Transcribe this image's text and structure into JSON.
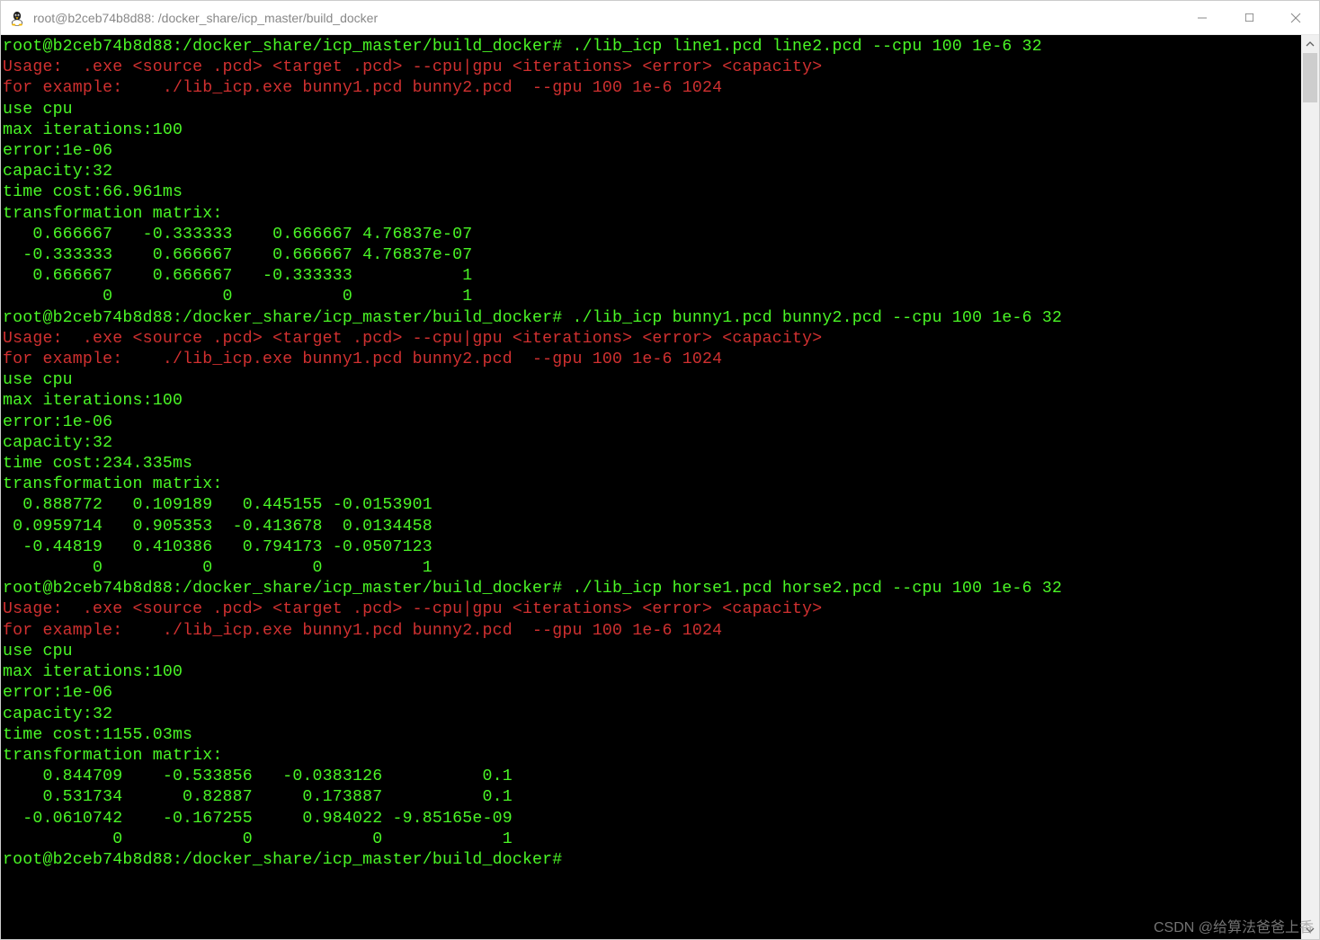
{
  "window": {
    "title": "root@b2ceb74b8d88: /docker_share/icp_master/build_docker"
  },
  "term": {
    "prompt": "root@b2ceb74b8d88:/docker_share/icp_master/build_docker#",
    "usage_line": "Usage:  .exe <source .pcd> <target .pcd> --cpu|gpu <iterations> <error> <capacity>",
    "example_line": "for example:    ./lib_icp.exe bunny1.pcd bunny2.pcd  --gpu 100 1e-6 1024",
    "use_cpu": "use cpu",
    "max_iter": "max iterations:100",
    "error": "error:1e-06",
    "capacity": "capacity:32",
    "matrix_label": "transformation matrix:",
    "runs": [
      {
        "cmd": " ./lib_icp line1.pcd line2.pcd --cpu 100 1e-6 32",
        "time": "time cost:66.961ms",
        "m1": "   0.666667   -0.333333    0.666667 4.76837e-07",
        "m2": "  -0.333333    0.666667    0.666667 4.76837e-07",
        "m3": "   0.666667    0.666667   -0.333333           1",
        "m4": "          0           0           0           1"
      },
      {
        "cmd": " ./lib_icp bunny1.pcd bunny2.pcd --cpu 100 1e-6 32",
        "time": "time cost:234.335ms",
        "m1": "  0.888772   0.109189   0.445155 -0.0153901",
        "m2": " 0.0959714   0.905353  -0.413678  0.0134458",
        "m3": "  -0.44819   0.410386   0.794173 -0.0507123",
        "m4": "         0          0          0          1"
      },
      {
        "cmd": " ./lib_icp horse1.pcd horse2.pcd --cpu 100 1e-6 32",
        "time": "time cost:1155.03ms",
        "m1": "    0.844709    -0.533856   -0.0383126          0.1",
        "m2": "    0.531734      0.82887     0.173887          0.1",
        "m3": "  -0.0610742    -0.167255     0.984022 -9.85165e-09",
        "m4": "           0            0            0            1"
      }
    ],
    "final_prompt_cursor": " "
  },
  "watermark": "CSDN @给算法爸爸上香"
}
